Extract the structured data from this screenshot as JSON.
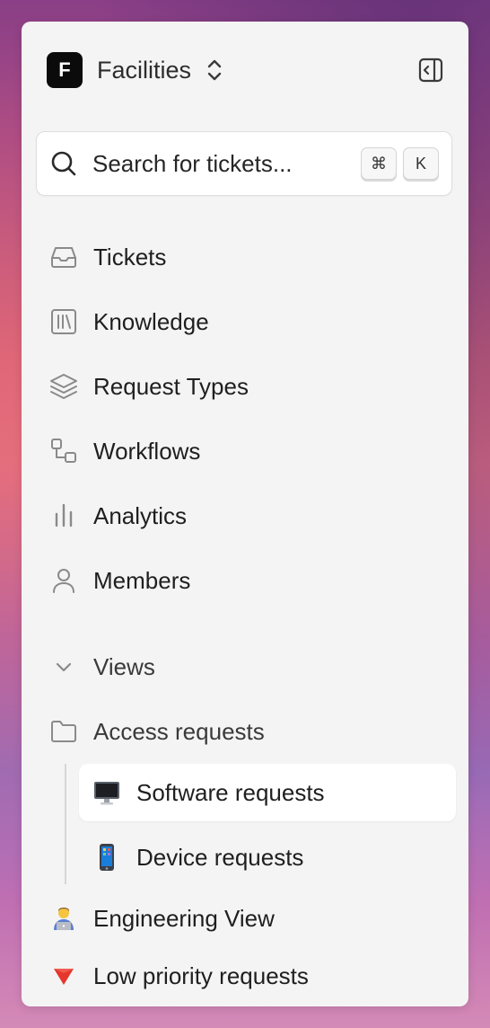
{
  "workspace": {
    "logo_letter": "F",
    "name": "Facilities"
  },
  "search": {
    "placeholder": "Search for tickets...",
    "shortcut_modifier": "⌘",
    "shortcut_key": "K"
  },
  "nav": {
    "items": [
      {
        "label": "Tickets",
        "icon": "inbox-icon"
      },
      {
        "label": "Knowledge",
        "icon": "library-icon"
      },
      {
        "label": "Request Types",
        "icon": "layers-icon"
      },
      {
        "label": "Workflows",
        "icon": "workflow-icon"
      },
      {
        "label": "Analytics",
        "icon": "bar-chart-icon"
      },
      {
        "label": "Members",
        "icon": "user-icon"
      }
    ]
  },
  "views": {
    "section_label": "Views",
    "folder": {
      "label": "Access requests",
      "icon": "folder-icon"
    },
    "children": [
      {
        "label": "Software requests",
        "emoji": "🖥️",
        "selected": true
      },
      {
        "label": "Device requests",
        "emoji": "📱",
        "selected": false
      }
    ],
    "items": [
      {
        "label": "Engineering View",
        "emoji": "🧑‍💻"
      },
      {
        "label": "Low priority requests",
        "emoji": "🔻"
      }
    ]
  },
  "colors": {
    "panel_bg": "#f4f4f4",
    "icon_gray": "#8a8a8a",
    "text": "#1f1f1f"
  }
}
